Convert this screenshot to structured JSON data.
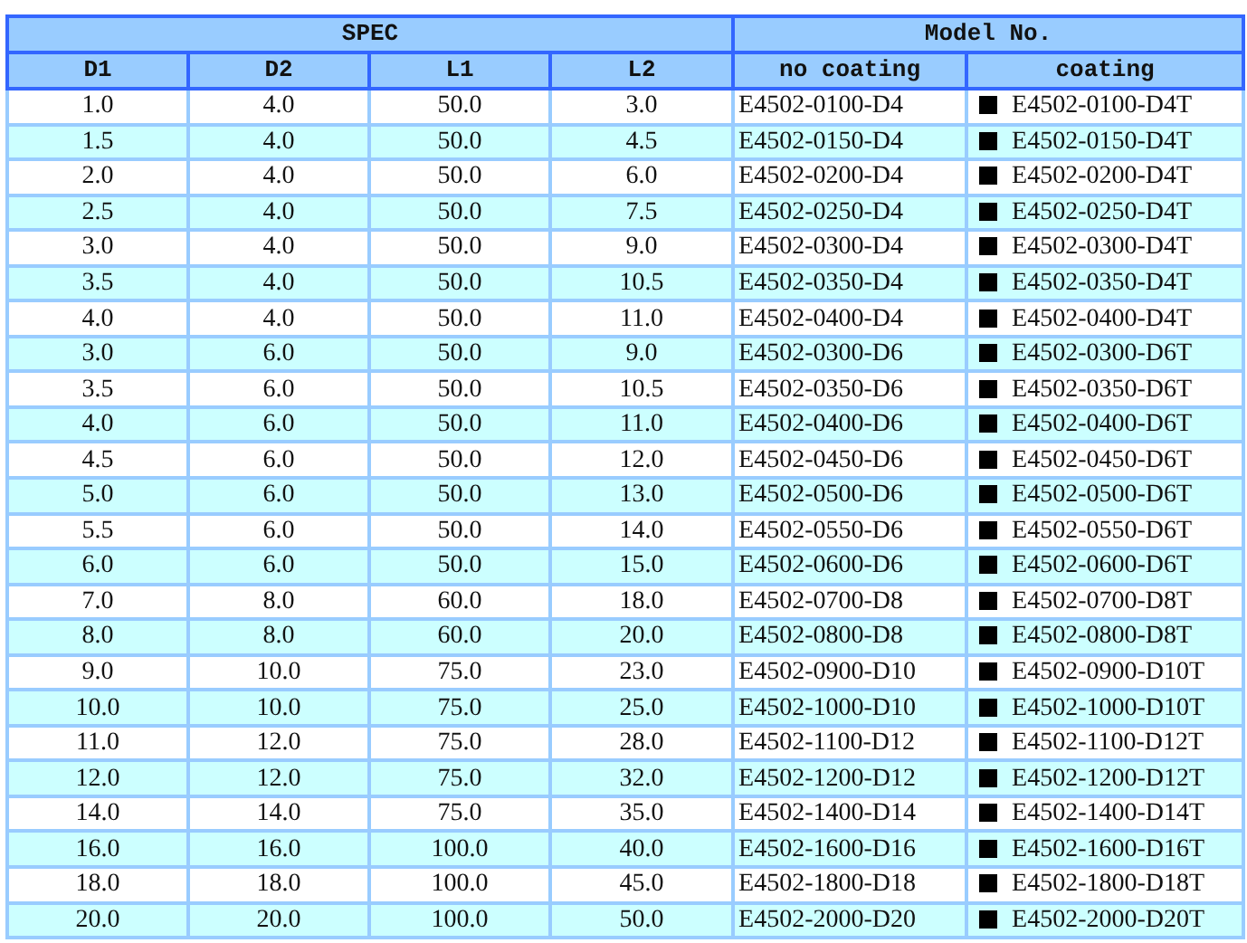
{
  "table": {
    "group_headers": [
      "SPEC",
      "Model No."
    ],
    "columns": [
      "D1",
      "D2",
      "L1",
      "L2",
      "no coating",
      "coating"
    ],
    "rows": [
      [
        "1.0",
        "4.0",
        "50.0",
        "3.0",
        "E4502-0100-D4",
        "E4502-0100-D4T"
      ],
      [
        "1.5",
        "4.0",
        "50.0",
        "4.5",
        "E4502-0150-D4",
        "E4502-0150-D4T"
      ],
      [
        "2.0",
        "4.0",
        "50.0",
        "6.0",
        "E4502-0200-D4",
        "E4502-0200-D4T"
      ],
      [
        "2.5",
        "4.0",
        "50.0",
        "7.5",
        "E4502-0250-D4",
        "E4502-0250-D4T"
      ],
      [
        "3.0",
        "4.0",
        "50.0",
        "9.0",
        "E4502-0300-D4",
        "E4502-0300-D4T"
      ],
      [
        "3.5",
        "4.0",
        "50.0",
        "10.5",
        "E4502-0350-D4",
        "E4502-0350-D4T"
      ],
      [
        "4.0",
        "4.0",
        "50.0",
        "11.0",
        "E4502-0400-D4",
        "E4502-0400-D4T"
      ],
      [
        "3.0",
        "6.0",
        "50.0",
        "9.0",
        "E4502-0300-D6",
        "E4502-0300-D6T"
      ],
      [
        "3.5",
        "6.0",
        "50.0",
        "10.5",
        "E4502-0350-D6",
        "E4502-0350-D6T"
      ],
      [
        "4.0",
        "6.0",
        "50.0",
        "11.0",
        "E4502-0400-D6",
        "E4502-0400-D6T"
      ],
      [
        "4.5",
        "6.0",
        "50.0",
        "12.0",
        "E4502-0450-D6",
        "E4502-0450-D6T"
      ],
      [
        "5.0",
        "6.0",
        "50.0",
        "13.0",
        "E4502-0500-D6",
        "E4502-0500-D6T"
      ],
      [
        "5.5",
        "6.0",
        "50.0",
        "14.0",
        "E4502-0550-D6",
        "E4502-0550-D6T"
      ],
      [
        "6.0",
        "6.0",
        "50.0",
        "15.0",
        "E4502-0600-D6",
        "E4502-0600-D6T"
      ],
      [
        "7.0",
        "8.0",
        "60.0",
        "18.0",
        "E4502-0700-D8",
        "E4502-0700-D8T"
      ],
      [
        "8.0",
        "8.0",
        "60.0",
        "20.0",
        "E4502-0800-D8",
        "E4502-0800-D8T"
      ],
      [
        "9.0",
        "10.0",
        "75.0",
        "23.0",
        "E4502-0900-D10",
        "E4502-0900-D10T"
      ],
      [
        "10.0",
        "10.0",
        "75.0",
        "25.0",
        "E4502-1000-D10",
        "E4502-1000-D10T"
      ],
      [
        "11.0",
        "12.0",
        "75.0",
        "28.0",
        "E4502-1100-D12",
        "E4502-1100-D12T"
      ],
      [
        "12.0",
        "12.0",
        "75.0",
        "32.0",
        "E4502-1200-D12",
        "E4502-1200-D12T"
      ],
      [
        "14.0",
        "14.0",
        "75.0",
        "35.0",
        "E4502-1400-D14",
        "E4502-1400-D14T"
      ],
      [
        "16.0",
        "16.0",
        "100.0",
        "40.0",
        "E4502-1600-D16",
        "E4502-1600-D16T"
      ],
      [
        "18.0",
        "18.0",
        "100.0",
        "45.0",
        "E4502-1800-D18",
        "E4502-1800-D18T"
      ],
      [
        "20.0",
        "20.0",
        "100.0",
        "50.0",
        "E4502-2000-D20",
        "E4502-2000-D20T"
      ]
    ]
  }
}
